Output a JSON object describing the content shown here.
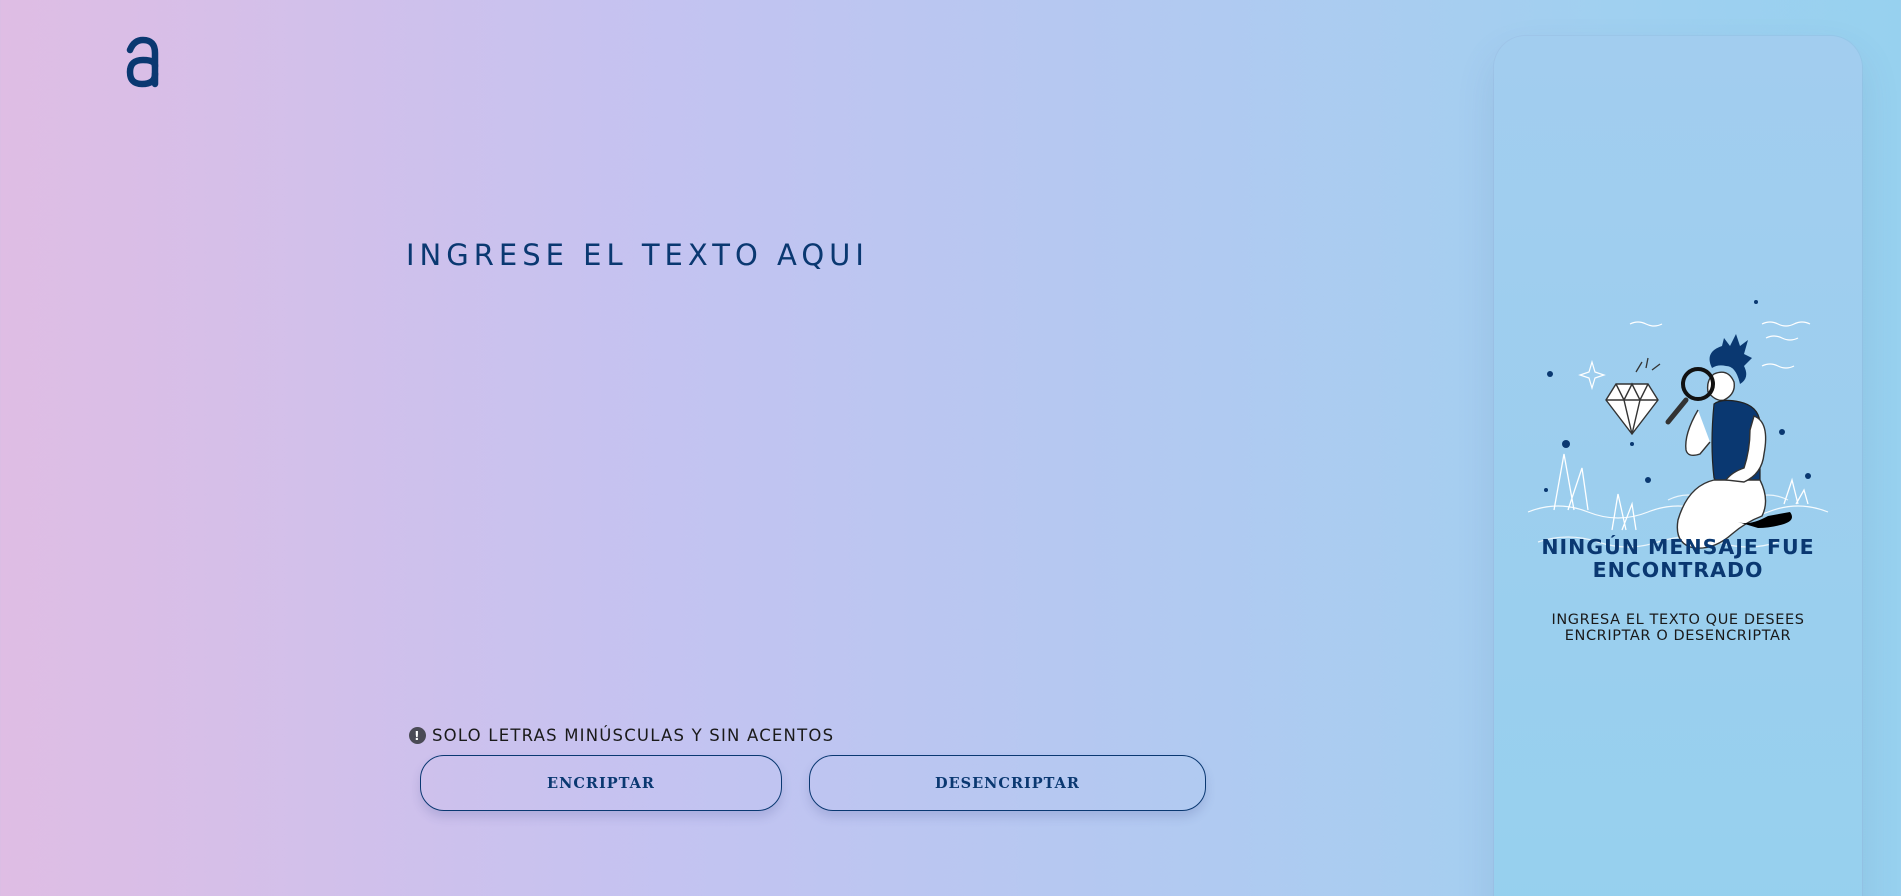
{
  "logo": {
    "icon": "alura-a-logo",
    "color": "#0a3871"
  },
  "editor": {
    "placeholder": "INGRESE EL TEXTO AQUI",
    "value": ""
  },
  "hint": {
    "icon": "exclamation-circle-icon",
    "text": "SOLO LETRAS MINÚSCULAS Y SIN ACENTOS"
  },
  "buttons": {
    "encrypt": "ENCRIPTAR",
    "decrypt": "DESENCRIPTAR"
  },
  "result_panel": {
    "illustration": "person-with-magnifying-glass-and-diamond",
    "title": "NINGÚN MENSAJE FUE ENCONTRADO",
    "text": "INGRESA EL TEXTO QUE DESEES ENCRIPTAR O DESENCRIPTAR"
  },
  "colors": {
    "accent": "#0a3871",
    "text_dark": "#1a1a1a"
  }
}
